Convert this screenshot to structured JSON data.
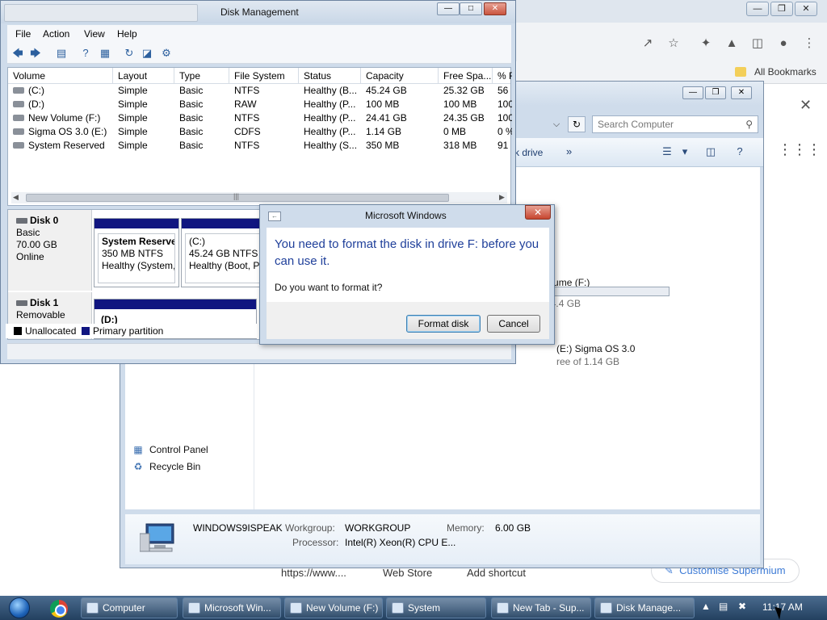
{
  "chrome": {
    "bookmarks_bar_label": "All Bookmarks",
    "new_tab_links": [
      "https://www....",
      "Web Store",
      "Add shortcut"
    ],
    "customise_button": "Customise Supermium"
  },
  "explorer": {
    "search_placeholder": "Search Computer",
    "toolbar_map_drive": "rk drive",
    "nav_items": [
      "Control Panel",
      "Recycle Bin"
    ],
    "drive_f": {
      "name": "New Volume (F:)",
      "free": "ree of 24.4 GB"
    },
    "drive_e": {
      "name": "(E:) Sigma OS 3.0",
      "free": "ree of 1.14 GB"
    },
    "details": {
      "computer_name": "WINDOWS9ISPEAK",
      "workgroup_label": "Workgroup:",
      "workgroup_value": "WORKGROUP",
      "memory_label": "Memory:",
      "memory_value": "6.00 GB",
      "processor_label": "Processor:",
      "processor_value": "Intel(R) Xeon(R) CPU E..."
    }
  },
  "diskmgmt": {
    "title": "Disk Management",
    "menu": [
      "File",
      "Action",
      "View",
      "Help"
    ],
    "columns": [
      "Volume",
      "Layout",
      "Type",
      "File System",
      "Status",
      "Capacity",
      "Free Spa...",
      "% F"
    ],
    "rows": [
      [
        "(C:)",
        "Simple",
        "Basic",
        "NTFS",
        "Healthy (B...",
        "45.24 GB",
        "25.32 GB",
        "56"
      ],
      [
        "(D:)",
        "Simple",
        "Basic",
        "RAW",
        "Healthy (P...",
        "100 MB",
        "100 MB",
        "100"
      ],
      [
        "New Volume (F:)",
        "Simple",
        "Basic",
        "NTFS",
        "Healthy (P...",
        "24.41 GB",
        "24.35 GB",
        "100"
      ],
      [
        "Sigma OS 3.0 (E:)",
        "Simple",
        "Basic",
        "CDFS",
        "Healthy (P...",
        "1.14 GB",
        "0 MB",
        "0 %"
      ],
      [
        "System Reserved",
        "Simple",
        "Basic",
        "NTFS",
        "Healthy (S...",
        "350 MB",
        "318 MB",
        "91"
      ]
    ],
    "disk0": {
      "title": "Disk 0",
      "type": "Basic",
      "size": "70.00 GB",
      "state": "Online",
      "partitions": [
        {
          "name": "System Reserve",
          "size": "350 MB NTFS",
          "status": "Healthy (System,"
        },
        {
          "name": "(C:)",
          "size": "45.24 GB NTFS",
          "status": "Healthy (Boot, Pa"
        }
      ]
    },
    "disk1": {
      "title": "Disk 1",
      "type": "Removable",
      "partition_name": "(D:)"
    },
    "legend": [
      "Unallocated",
      "Primary partition"
    ],
    "colors": {
      "unallocated": "#000000",
      "primary": "#101580"
    }
  },
  "dialog": {
    "title": "Microsoft Windows",
    "message": "You need to format the disk in drive F: before you can use it.",
    "question": "Do you want to format it?",
    "format_button": "Format disk",
    "cancel_button": "Cancel",
    "message_color": "#1f3f9a"
  },
  "taskbar": {
    "items": [
      "Computer",
      "Microsoft Win...",
      "New Volume (F:)",
      "System",
      "New Tab - Sup...",
      "Disk Manage..."
    ],
    "clock": "11:17 AM"
  }
}
